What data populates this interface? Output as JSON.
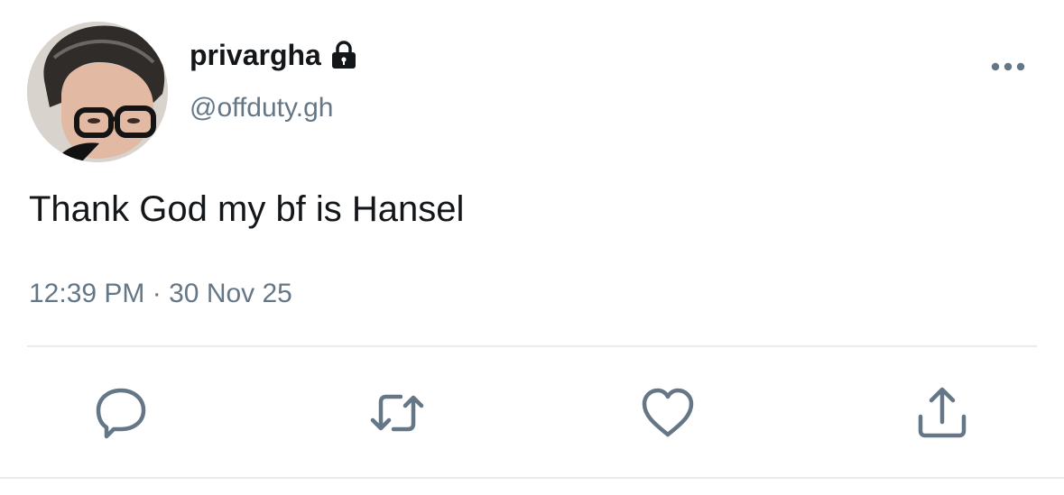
{
  "tweet": {
    "author": {
      "display_name": "privargha",
      "handle": "@offduty.gh",
      "protected_icon": "lock-icon",
      "avatar": "profile photo"
    },
    "text": "Thank God my bf is Hansel",
    "time": "12:39 PM",
    "separator": "·",
    "date": "30 Nov 25"
  },
  "actions": [
    {
      "icon": "reply-icon"
    },
    {
      "icon": "retweet-icon"
    },
    {
      "icon": "like-icon"
    },
    {
      "icon": "share-icon"
    }
  ],
  "menu": {
    "icon": "more-options-icon"
  },
  "colors": {
    "text_primary": "#14171a",
    "text_secondary": "#657786",
    "divider": "#e6ecf0",
    "icon": "#657786"
  }
}
